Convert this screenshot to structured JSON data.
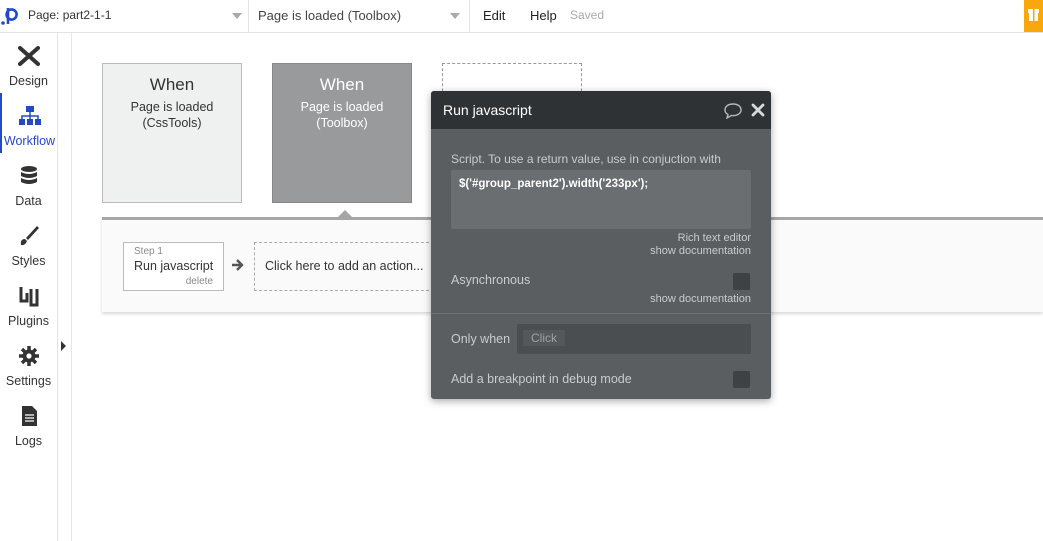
{
  "topbar": {
    "page_label": "Page: part2-1-1",
    "event_label": "Page is loaded (Toolbox)",
    "edit": "Edit",
    "help": "Help",
    "status": "Saved"
  },
  "sidebar": {
    "items": [
      {
        "label": "Design",
        "icon": "design-icon"
      },
      {
        "label": "Workflow",
        "icon": "workflow-icon",
        "active": true
      },
      {
        "label": "Data",
        "icon": "database-icon"
      },
      {
        "label": "Styles",
        "icon": "brush-icon"
      },
      {
        "label": "Plugins",
        "icon": "plug-icon"
      },
      {
        "label": "Settings",
        "icon": "gear-icon"
      },
      {
        "label": "Logs",
        "icon": "document-icon"
      }
    ]
  },
  "events": [
    {
      "when": "When",
      "line1": "Page is loaded",
      "line2": "(CssTools)"
    },
    {
      "when": "When",
      "line1": "Page is loaded",
      "line2": "(Toolbox)"
    }
  ],
  "workflow": {
    "step_num": "Step 1",
    "step_name": "Run javascript",
    "step_delete": "delete",
    "add_action": "Click here to add an action..."
  },
  "modal": {
    "title": "Run javascript",
    "script_label": "Script. To use a return value, use in conjuction with",
    "script_value": "$('#group_parent2').width('233px');",
    "rich_text_editor": "Rich text editor",
    "show_documentation": "show documentation",
    "asynchronous": "Asynchronous",
    "only_when": "Only when",
    "only_when_placeholder": "Click",
    "breakpoint": "Add a breakpoint in debug mode"
  },
  "colors": {
    "accent": "#2348c8",
    "gift": "#f8a80c",
    "modal_bg": "#5a5e61",
    "modal_header": "#2f3234"
  }
}
